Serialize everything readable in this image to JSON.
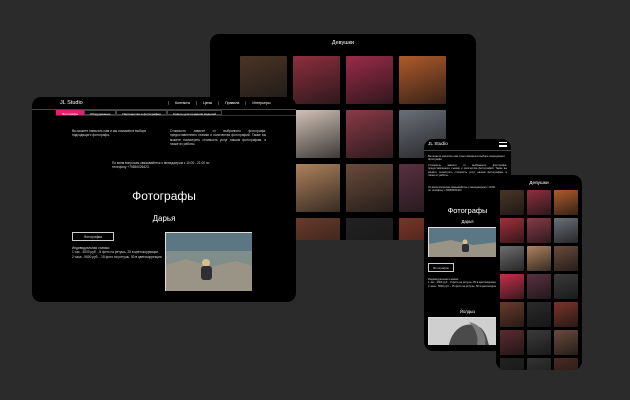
{
  "gallery_back": {
    "title": "Девушки",
    "photos": [
      "#4a3526",
      "#8e2f3e",
      "#9a2b48",
      "#b05a2b",
      "#a52e3a",
      "#d4c4b8",
      "#8a3a46",
      "#6b6f78",
      "#6e6e6e",
      "#b0835e",
      "#6a4a3a",
      "#5a3040",
      "#3a3a3a",
      "#6a3b2a",
      "#222",
      "#7a3428"
    ]
  },
  "desktop": {
    "logo": "JL Studio",
    "nav": [
      "Контакты",
      "Цены",
      "Правила",
      "Интерьеры"
    ],
    "tabs": [
      "Фотографы",
      "Оборудование",
      "Партнерство в фотографии",
      "Советы для создания моделей"
    ],
    "intro_left": "Вы можете написать нам и мы поможем в выборе подходящего фотографа.",
    "intro_right": "Стоимость зависит от выбранного фотографа, предоставленного съемки и количества фотографий. Также вы можете посмотреть стоимость услуг нашим фотографам, а также их работы.",
    "contact": "По всем вопросам связывайтесь с менеджером с 10:00 - 21:00 по телефону +79650026423.",
    "heading": "Фотографы",
    "photographer_name": "Дарья",
    "works_button": "Фотографии",
    "price_title": "Индивидуальная съемка:",
    "price_1": "1 час - 3000 руб. - 8 фото на ретушь, 25 в цветокоррекции",
    "price_2": "2 часа - 5600 руб. - 15 фото на ретушь, 50 в цветокоррекции"
  },
  "mobile": {
    "logo": "JL Studio",
    "intro_1": "Вы можете написать нам и мы поможем в выборе подходящего фотографа.",
    "intro_2": "Стоимость зависит от выбранного фотографа, предоставленного съемки и количества фотографий. Также вы можете посмотреть стоимость услуг нашим фотографам, а также их работы.",
    "contact": "По всем вопросам связывайтесь с менеджером с 10:00 - 21:00 по телефону +79650026423.",
    "heading": "Фотографы",
    "photographer_name": "Дарья",
    "works_button": "Фотографии",
    "price_title": "Индивидуальная съемка:",
    "price_1": "1 час - 3000 руб. - 8 фото на ретушь, 25 в цветокоррекции",
    "price_2": "2 часа - 5600 руб. - 15 фото на ретушь, 50 в цветокоррекции",
    "photographer_2": "Йолдыз"
  },
  "gallery_mobile": {
    "title": "Девушки",
    "photos": [
      "#4a3526",
      "#8e2f3e",
      "#b05a2b",
      "#a52e3a",
      "#8a3a46",
      "#6b6f78",
      "#6e6e6e",
      "#b0835e",
      "#6a4a3a",
      "#c42f4a",
      "#5a3040",
      "#3a3a3a",
      "#6a3b2a",
      "#2a2a2a",
      "#7a3428",
      "#5c2a30",
      "#3b3b3b",
      "#6a4a3a",
      "#222",
      "#333",
      "#4a2a22"
    ]
  },
  "colors": {
    "background": "#2b2b2b",
    "accent": "#e0216f",
    "frame": "#000000"
  }
}
